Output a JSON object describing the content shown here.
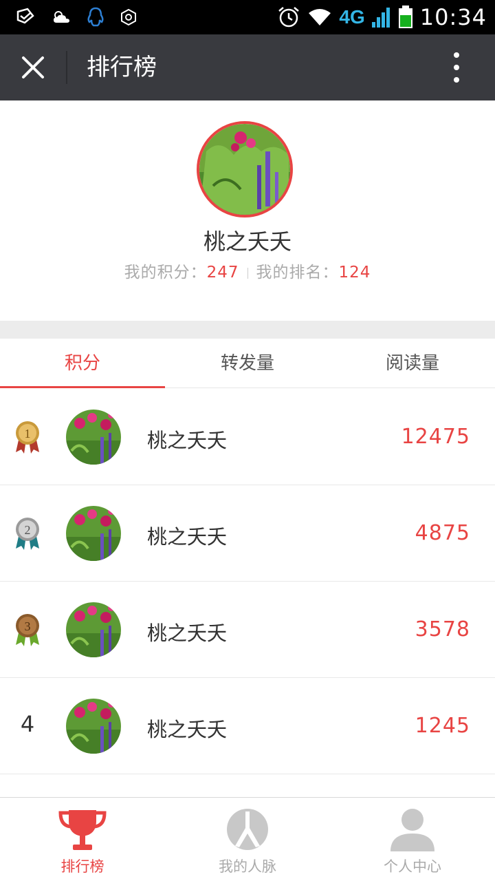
{
  "status_bar": {
    "network": "4G",
    "time": "10:34",
    "icons": [
      "message-icon",
      "weather-icon",
      "qq-icon",
      "settings-hex-icon",
      "alarm-icon",
      "wifi-icon",
      "signal-icon",
      "battery-icon"
    ]
  },
  "header": {
    "title": "排行榜",
    "close_icon": "close-icon",
    "more_icon": "more-vertical-icon"
  },
  "profile": {
    "name": "桃之夭夭",
    "score_label": "我的积分：",
    "score_value": "247",
    "rank_label": "我的排名：",
    "rank_value": "124"
  },
  "tabs": [
    {
      "label": "积分",
      "active": true
    },
    {
      "label": "转发量",
      "active": false
    },
    {
      "label": "阅读量",
      "active": false
    }
  ],
  "leaderboard": [
    {
      "rank": "1",
      "badge": "gold-medal-icon",
      "name": "桃之夭夭",
      "score": "12475"
    },
    {
      "rank": "2",
      "badge": "silver-medal-icon",
      "name": "桃之夭夭",
      "score": "4875"
    },
    {
      "rank": "3",
      "badge": "bronze-medal-icon",
      "name": "桃之夭夭",
      "score": "3578"
    },
    {
      "rank": "4",
      "badge": "",
      "name": "桃之夭夭",
      "score": "1245"
    }
  ],
  "bottom_nav": [
    {
      "label": "排行榜",
      "icon": "trophy-icon",
      "active": true
    },
    {
      "label": "我的人脉",
      "icon": "network-people-icon",
      "active": false
    },
    {
      "label": "个人中心",
      "icon": "user-profile-icon",
      "active": false
    }
  ],
  "colors": {
    "accent": "#e84443",
    "title_bar": "#393a3f",
    "status_bar": "#000000",
    "muted_text": "#aaaaaa"
  }
}
